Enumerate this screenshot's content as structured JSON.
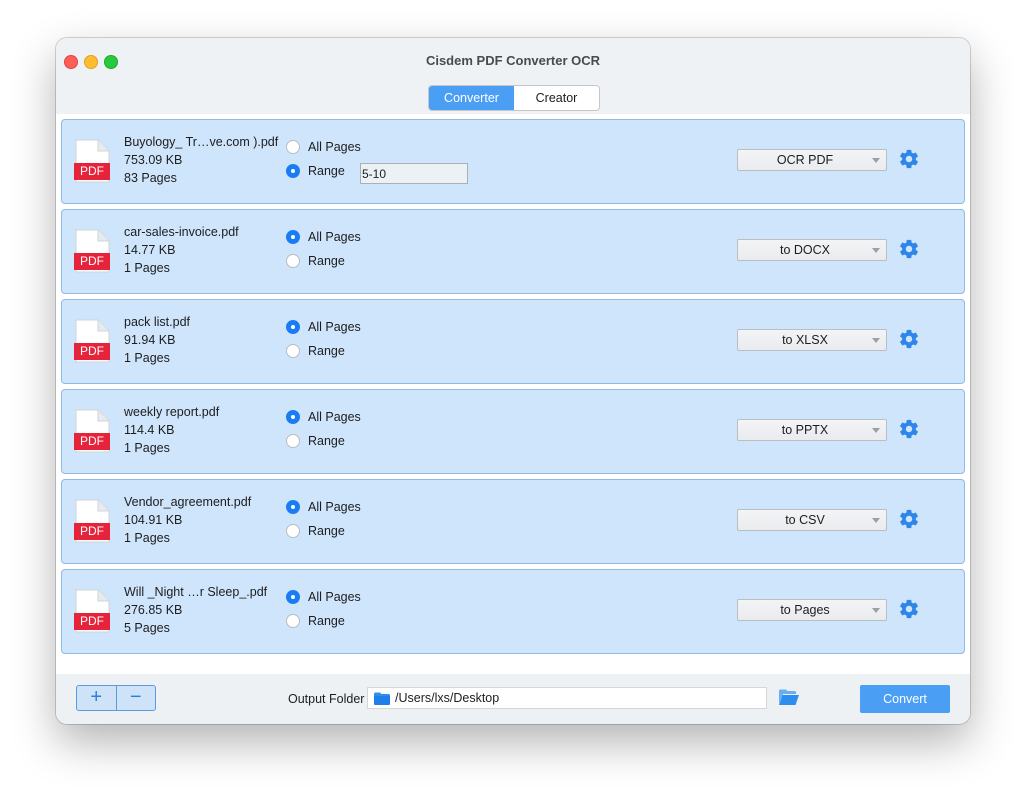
{
  "window": {
    "title": "Cisdem PDF Converter OCR"
  },
  "tabs": [
    {
      "label": "Converter",
      "active": true
    },
    {
      "label": "Creator",
      "active": false
    }
  ],
  "files": [
    {
      "name": "Buyology_ Tr…ve.com ).pdf",
      "size": "753.09 KB",
      "pages": "83 Pages",
      "type_badge": "PDF",
      "page_mode": "range",
      "all_pages_label": "All Pages",
      "range_label": "Range",
      "range_value": "5-10",
      "format": "OCR PDF"
    },
    {
      "name": "car-sales-invoice.pdf",
      "size": "14.77 KB",
      "pages": "1 Pages",
      "type_badge": "PDF",
      "page_mode": "all",
      "all_pages_label": "All Pages",
      "range_label": "Range",
      "format": "to DOCX"
    },
    {
      "name": "pack list.pdf",
      "size": "91.94 KB",
      "pages": "1 Pages",
      "type_badge": "PDF",
      "page_mode": "all",
      "all_pages_label": "All Pages",
      "range_label": "Range",
      "format": "to XLSX"
    },
    {
      "name": "weekly report.pdf",
      "size": "114.4 KB",
      "pages": "1 Pages",
      "type_badge": "PDF",
      "page_mode": "all",
      "all_pages_label": "All Pages",
      "range_label": "Range",
      "format": "to PPTX"
    },
    {
      "name": "Vendor_agreement.pdf",
      "size": "104.91 KB",
      "pages": "1 Pages",
      "type_badge": "PDF",
      "page_mode": "all",
      "all_pages_label": "All Pages",
      "range_label": "Range",
      "format": "to CSV"
    },
    {
      "name": "Will _Night …r Sleep_.pdf",
      "size": "276.85 KB",
      "pages": "5 Pages",
      "type_badge": "PDF",
      "page_mode": "all",
      "all_pages_label": "All Pages",
      "range_label": "Range",
      "format": "to Pages"
    }
  ],
  "footer": {
    "add_label": "+",
    "remove_label": "−",
    "output_folder_label": "Output Folder",
    "output_path": "/Users/lxs/Desktop",
    "convert_label": "Convert"
  },
  "icons": {
    "file": "document-icon",
    "settings": "gear-icon",
    "folder": "folder-icon",
    "browse": "open-folder-icon"
  },
  "colors": {
    "accent": "#4a9ff5",
    "row_background": "#cfe5fb",
    "row_border": "#8fbbe5",
    "pdf_badge": "#e5243b",
    "gear": "#2f86e8"
  }
}
